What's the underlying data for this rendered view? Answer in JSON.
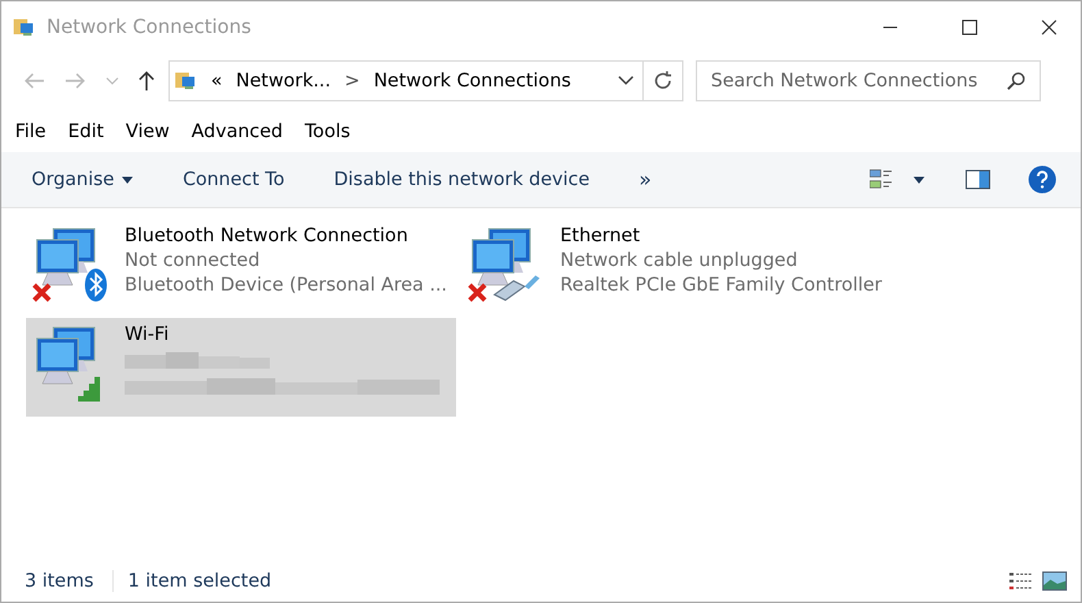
{
  "window": {
    "title": "Network Connections"
  },
  "address": {
    "overflow": "«",
    "crumbs": [
      "Network...",
      "Network Connections"
    ],
    "separator": ">"
  },
  "search": {
    "placeholder": "Search Network Connections"
  },
  "menu": [
    "File",
    "Edit",
    "View",
    "Advanced",
    "Tools"
  ],
  "commands": [
    {
      "label": "Organise",
      "kind": "dropdown"
    },
    {
      "label": "Connect To",
      "kind": "plain"
    },
    {
      "label": "Disable this network device",
      "kind": "plain"
    },
    {
      "label": "»",
      "kind": "more"
    }
  ],
  "connections": [
    {
      "name": "Bluetooth Network Connection",
      "status": "Not connected",
      "device": "Bluetooth Device (Personal Area ...",
      "kind": "bluetooth",
      "disconnected": true,
      "selected": false
    },
    {
      "name": "Ethernet",
      "status": "Network cable unplugged",
      "device": "Realtek PCIe GbE Family Controller",
      "kind": "ethernet",
      "disconnected": true,
      "selected": false
    },
    {
      "name": "Wi-Fi",
      "kind": "wifi",
      "redacted": true,
      "disconnected": false,
      "selected": true
    }
  ],
  "status_bar": {
    "count": "3 items",
    "selection": "1 item selected"
  }
}
